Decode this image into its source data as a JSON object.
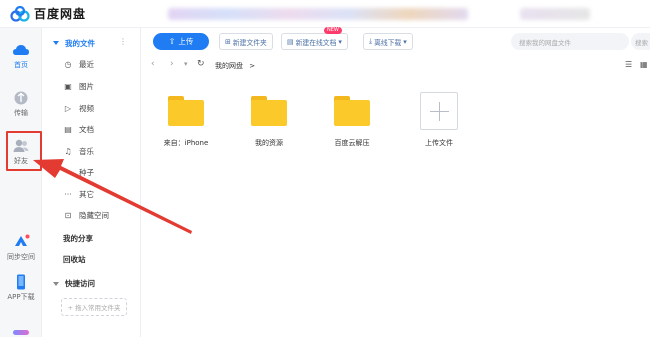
{
  "app": {
    "title": "百度网盘"
  },
  "rail": {
    "items": [
      {
        "label": "首页",
        "icon": "cloud-home-icon"
      },
      {
        "label": "传输",
        "icon": "transfer-icon"
      },
      {
        "label": "好友",
        "icon": "friends-icon"
      },
      {
        "label": "同步空间",
        "icon": "sync-space-icon"
      },
      {
        "label": "APP下载",
        "icon": "phone-icon"
      }
    ]
  },
  "sidebar": {
    "header": "我的文件",
    "header_menu": "⋮",
    "items": [
      {
        "label": "最近",
        "icon": "clock-icon"
      },
      {
        "label": "图片",
        "icon": "image-icon"
      },
      {
        "label": "视频",
        "icon": "video-icon"
      },
      {
        "label": "文档",
        "icon": "document-icon"
      },
      {
        "label": "音乐",
        "icon": "music-icon"
      },
      {
        "label": "种子",
        "icon": "seed-icon"
      },
      {
        "label": "其它",
        "icon": "more-icon"
      },
      {
        "label": "隐藏空间",
        "icon": "lock-icon"
      }
    ],
    "my_share": "我的分享",
    "recycle": "回收站",
    "quick_access": "快捷访问",
    "drop_hint": "+ 拖入常用文件夹"
  },
  "toolbar": {
    "upload": "上传",
    "new_folder": "新建文件夹",
    "new_online_doc": "新建在线文档",
    "new_badge": "NEW",
    "offline_download": "离线下载",
    "search_placeholder": "搜索我的网盘文件",
    "search2_placeholder": "搜索"
  },
  "breadcrumb": {
    "path": "我的网盘",
    "sep": ">"
  },
  "files": [
    {
      "name": "来自：iPhone",
      "type": "folder"
    },
    {
      "name": "我的资源",
      "type": "folder"
    },
    {
      "name": "百度云解压",
      "type": "folder"
    },
    {
      "name": "上传文件",
      "type": "upload"
    }
  ],
  "colors": {
    "accent": "#1f7cf2",
    "folder": "#fcc92b",
    "annotation": "#e33b32"
  }
}
